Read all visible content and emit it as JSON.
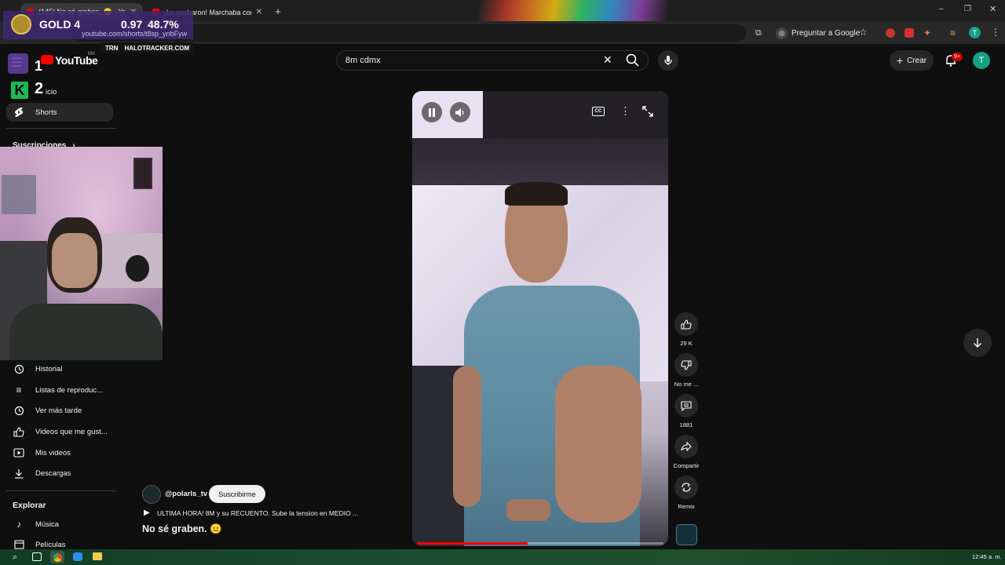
{
  "browser": {
    "tabs": [
      {
        "label": "(145) No sé graben. 😐 - Yo",
        "active": true
      },
      {
        "label": "¡Lo cacharon! Marchaba como",
        "active": false
      }
    ],
    "new_tab_icon": "plus-icon",
    "ask_google_label": "Preguntar a Google",
    "url_partial": "youtube.com/shorts/t8sp_ynbFyw"
  },
  "overlay": {
    "rank": "GOLD 4",
    "kd": "0.97",
    "winrate": "48.7%",
    "brand_short": "TRN",
    "brand_site": "HALOTRACKER.COM",
    "score_1": "1",
    "score_2": "2"
  },
  "youtube": {
    "logo_text": "YouTube",
    "region": "MX",
    "search_value": "8m cdmx",
    "create_label": "Crear",
    "notifications_badge": "9+",
    "avatar_letter": "T",
    "accent": "#ff0000"
  },
  "sidebar": {
    "home_partial": "icio",
    "shorts": "Shorts",
    "subscriptions": "Suscripciones",
    "items": [
      {
        "label": "Historial",
        "icon": "history-icon"
      },
      {
        "label": "Listas de reproduc...",
        "icon": "playlist-icon"
      },
      {
        "label": "Ver más tarde",
        "icon": "watch-later-icon"
      },
      {
        "label": "Videos que me gust...",
        "icon": "liked-icon"
      },
      {
        "label": "Mis videos",
        "icon": "my-videos-icon"
      },
      {
        "label": "Descargas",
        "icon": "download-icon"
      }
    ],
    "explore_heading": "Explorar",
    "explore_items": [
      {
        "label": "Música",
        "icon": "music-icon"
      },
      {
        "label": "Películas",
        "icon": "movies-icon"
      }
    ]
  },
  "short": {
    "channel": "@polarls_tv",
    "subscribe_label": "Suscribirme",
    "playlist_line": "ULTIMA HORA! 8M y su RECUENTO. Sube la tension en MEDIO ...",
    "title": "No sé graben. 😐",
    "progress": 0.45,
    "actions": {
      "likes": "29 K",
      "dislike_label": "No me ...",
      "comments": "1881",
      "share_label": "Compartir",
      "remix_label": "Remix"
    }
  },
  "taskbar": {
    "clock": "12:45 a. m."
  }
}
